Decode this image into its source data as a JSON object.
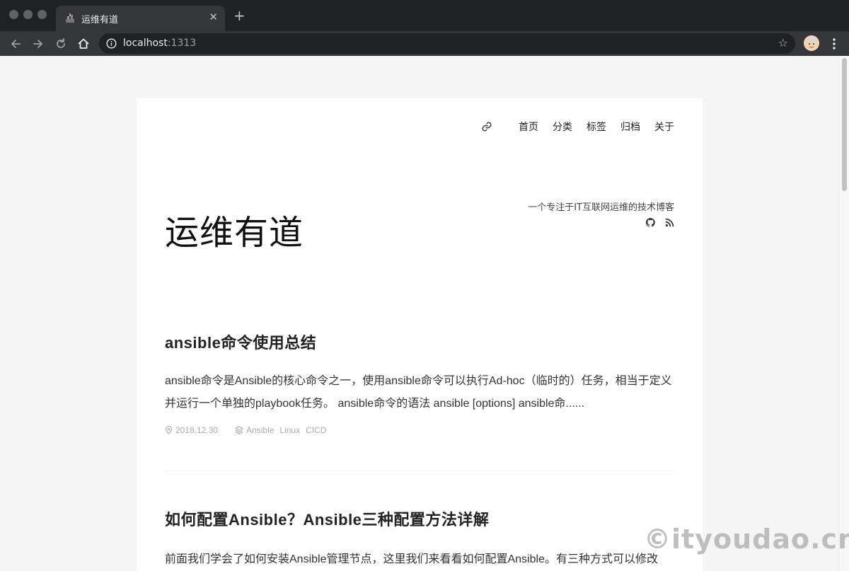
{
  "browser": {
    "tab_title": "运维有道",
    "url_host": "localhost",
    "url_port": ":1313"
  },
  "nav": {
    "items": [
      "首页",
      "分类",
      "标签",
      "归档",
      "关于"
    ]
  },
  "header": {
    "site_title": "运维有道",
    "description": "一个专注于IT互联网运维的技术博客"
  },
  "posts": [
    {
      "title": "ansible命令使用总结",
      "excerpt": "ansible命令是Ansible的核心命令之一，使用ansible命令可以执行Ad-hoc（临时的）任务，相当于定义并运行一个单独的playbook任务。 ansible命令的语法 ansible [options] ansible命......",
      "date": "2018.12.30",
      "tags": [
        "Ansible",
        "Linux",
        "CICD"
      ]
    },
    {
      "title": "如何配置Ansible？Ansible三种配置方法详解",
      "excerpt": "前面我们学会了如何安装Ansible管理节点，这里我们来看看如何配置Ansible。有三种方式可以修改"
    }
  ],
  "watermark": "©ityoudao.cn",
  "colors": {
    "chrome_dark": "#202124",
    "chrome_toolbar": "#35363a",
    "page_bg": "#f5f5f5",
    "card_bg": "#ffffff",
    "meta_gray": "#aaaaaa"
  }
}
